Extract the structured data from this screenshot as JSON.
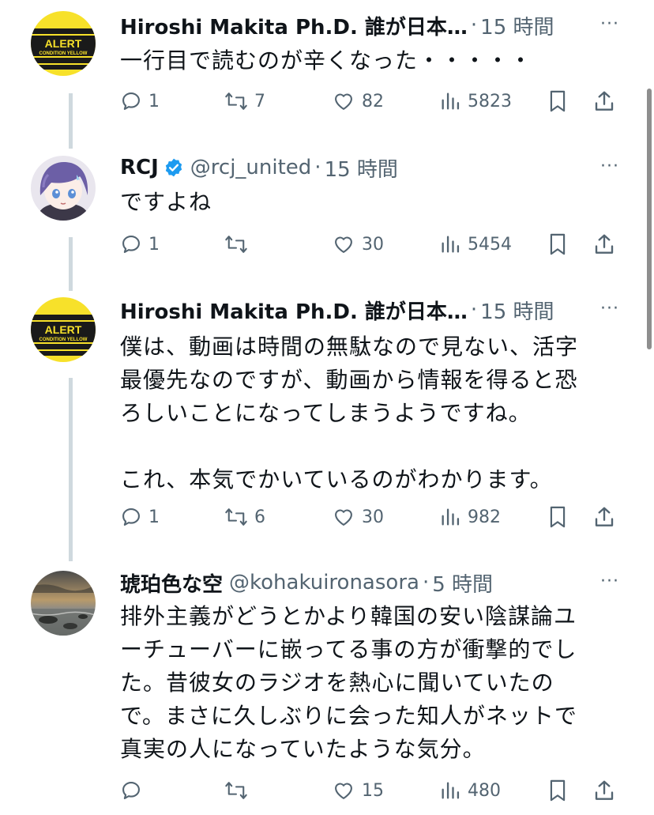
{
  "tweets": [
    {
      "name": "Hiroshi Makita Ph.D. 誰が日本…",
      "handle": "",
      "separator": "·",
      "time": "15 時間",
      "more": "···",
      "verified": false,
      "avatar": "alert-condition-yellow",
      "avatar_text": [
        "ALERT",
        "CONDITION YELLOW"
      ],
      "body": "一行目で読むのが辛くなった・・・・・",
      "replies": "1",
      "retweets": "7",
      "likes": "82",
      "views": "5823"
    },
    {
      "name": "RCJ",
      "handle": "@rcj_united",
      "separator": "·",
      "time": "15 時間",
      "more": "···",
      "verified": true,
      "avatar": "anime-character",
      "body": "ですよね",
      "replies": "1",
      "retweets": "",
      "likes": "30",
      "views": "5454"
    },
    {
      "name": "Hiroshi Makita Ph.D. 誰が日本…",
      "handle": "",
      "separator": "·",
      "time": "15 時間",
      "more": "···",
      "verified": false,
      "avatar": "alert-condition-yellow",
      "avatar_text": [
        "ALERT",
        "CONDITION YELLOW"
      ],
      "body": "僕は、動画は時間の無駄なので見ない、活字\n最優先なのですが、動画から情報を得ると恐\nろしいことになってしまうようですね。\n\nこれ、本気でかいているのがわかります。",
      "replies": "1",
      "retweets": "6",
      "likes": "30",
      "views": "982"
    },
    {
      "name": "琥珀色な空",
      "handle": "@kohakuironasora",
      "separator": "·",
      "time": "5 時間",
      "more": "···",
      "verified": false,
      "avatar": "seascape-photo",
      "body": "排外主義がどうとかより韓国の安い陰謀論ユ\nーチューバーに嵌ってる事の方が衝撃的でし\nた。昔彼女のラジオを熱心に聞いていたの\nで。まさに久しぶりに会った知人がネットで\n真実の人になっていたような気分。",
      "replies": "",
      "retweets": "",
      "likes": "15",
      "views": "480"
    }
  ],
  "colors": {
    "text": "#0f1419",
    "secondary": "#536471",
    "thread_line": "#cfd9de",
    "verified": "#1d9bf0",
    "alert_yellow": "#f7e12a"
  }
}
